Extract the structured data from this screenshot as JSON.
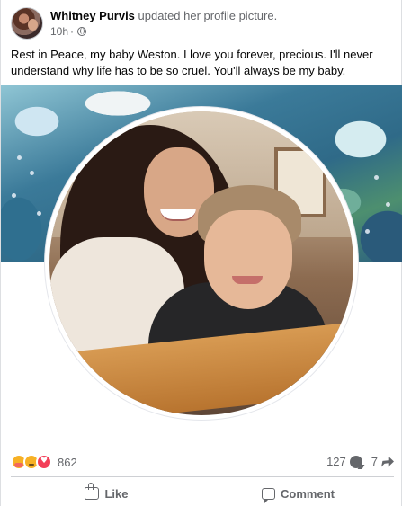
{
  "post": {
    "author": "Whitney Purvis",
    "action": "updated her profile picture.",
    "time": "10h",
    "privacy_icon": "globe-icon",
    "caption": "Rest in Peace, my baby Weston.  I love you forever, precious. I'll never understand why life has to be so cruel.  You'll always be my baby."
  },
  "reactions": {
    "types": [
      "care",
      "sad",
      "love"
    ],
    "count": "862"
  },
  "stats": {
    "comments": "127",
    "shares": "7"
  },
  "actions": {
    "like": "Like",
    "comment": "Comment"
  },
  "colors": {
    "text": "#050505",
    "secondary": "#65676b",
    "love": "#f33e58",
    "emoji": "#f7b125",
    "divider": "#ced0d4"
  }
}
